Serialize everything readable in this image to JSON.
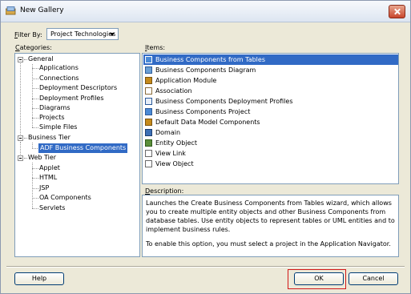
{
  "window": {
    "title": "New Gallery"
  },
  "filter": {
    "label_pre": "",
    "label_accel": "F",
    "label_post": "ilter By:",
    "value": "Project Technologies"
  },
  "categories": {
    "label_accel": "C",
    "label_post": "ategories:",
    "nodes": [
      {
        "label": "General"
      },
      {
        "label": "Applications"
      },
      {
        "label": "Connections"
      },
      {
        "label": "Deployment Descriptors"
      },
      {
        "label": "Deployment Profiles"
      },
      {
        "label": "Diagrams"
      },
      {
        "label": "Projects"
      },
      {
        "label": "Simple Files"
      },
      {
        "label": "Business Tier"
      },
      {
        "label": "ADF Business Components"
      },
      {
        "label": "Web Tier"
      },
      {
        "label": "Applet"
      },
      {
        "label": "HTML"
      },
      {
        "label": "JSP"
      },
      {
        "label": "OA Components"
      },
      {
        "label": "Servlets"
      }
    ]
  },
  "items": {
    "label_accel": "I",
    "label_post": "tems:",
    "list": [
      {
        "label": "Business Components from Tables",
        "icon": "table-wizard-icon",
        "color": "#4a8ad6"
      },
      {
        "label": "Business Components Diagram",
        "icon": "diagram-icon",
        "color": "#6a9fd4"
      },
      {
        "label": "Application Module",
        "icon": "application-module-icon",
        "color": "#c58a1a"
      },
      {
        "label": "Association",
        "icon": "association-icon",
        "color": "#8a6d3b"
      },
      {
        "label": "Business Components Deployment Profiles",
        "icon": "deployment-profile-icon",
        "color": "#6a9fd4"
      },
      {
        "label": "Business Components Project",
        "icon": "project-icon",
        "color": "#4a8ad6"
      },
      {
        "label": "Default Data Model Components",
        "icon": "data-model-icon",
        "color": "#c58a1a"
      },
      {
        "label": "Domain",
        "icon": "domain-icon",
        "color": "#3c6fb5"
      },
      {
        "label": "Entity Object",
        "icon": "entity-object-icon",
        "color": "#5b8f3a"
      },
      {
        "label": "View Link",
        "icon": "view-link-icon",
        "color": "#6a6a6a"
      },
      {
        "label": "View Object",
        "icon": "view-object-icon",
        "color": "#6a6a6a"
      }
    ]
  },
  "description": {
    "label_accel": "D",
    "label_post": "escription:",
    "para1": "Launches the Create Business Components from Tables wizard, which allows you to create multiple entity objects and other Business Components from database tables. Use entity objects to represent tables or UML entities and to implement business rules.",
    "para2": "To enable this option, you must select a project in the Application Navigator."
  },
  "buttons": {
    "help": "Help",
    "ok": "OK",
    "cancel": "Cancel"
  },
  "colors": {
    "selection": "#316ac5",
    "highlight_box": "#d21818"
  }
}
